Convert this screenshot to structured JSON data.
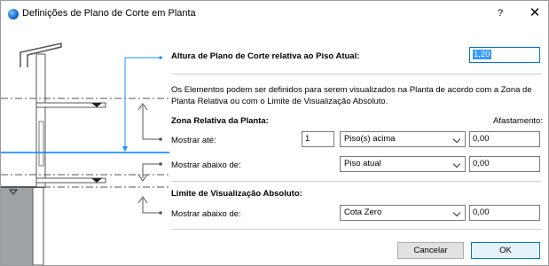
{
  "window": {
    "title": "Definições de Plano de Corte em Planta",
    "help_label": "?",
    "close_label": "✕"
  },
  "cut_height": {
    "label": "Altura de Plano de Corte relativa ao Piso Atual:",
    "value_selected": "1,20"
  },
  "description": "Os Elementos podem ser definidos para serem visualizados na Planta de acordo com a Zona de Planta Relativa ou com o Limite de Visualização Absoluto.",
  "relative_zone": {
    "heading": "Zona Relativa da Planta:",
    "offset_heading": "Afastamento:",
    "show_to": {
      "label": "Mostrar até:",
      "count": "1",
      "reference": "Piso(s) acima",
      "offset": "0,00"
    },
    "show_below": {
      "label": "Mostrar abaixo de:",
      "reference": "Piso atual",
      "offset": "0,00"
    }
  },
  "absolute_limit": {
    "heading": "Limite de Visualização Absoluto:",
    "show_below": {
      "label": "Mostrar abaixo de:",
      "reference": "Cota Zero",
      "offset": "0,00"
    }
  },
  "buttons": {
    "cancel": "Cancelar",
    "ok": "OK"
  },
  "colors": {
    "accent": "#0078d7",
    "cut_plane_line": "#1e90ff",
    "selection": "#3399ff"
  }
}
